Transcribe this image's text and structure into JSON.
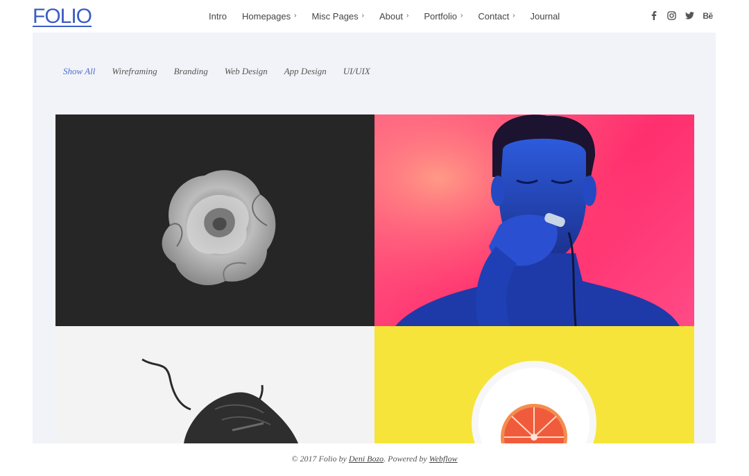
{
  "brand": {
    "logo_text": "FOLIO",
    "accent": "#3b5cc4"
  },
  "nav": {
    "items": [
      {
        "label": "Intro",
        "has_dropdown": false
      },
      {
        "label": "Homepages",
        "has_dropdown": true
      },
      {
        "label": "Misc Pages",
        "has_dropdown": true
      },
      {
        "label": "About",
        "has_dropdown": true
      },
      {
        "label": "Portfolio",
        "has_dropdown": true
      },
      {
        "label": "Contact",
        "has_dropdown": true
      },
      {
        "label": "Journal",
        "has_dropdown": false
      }
    ],
    "dropdown_glyph": "›"
  },
  "social": {
    "icons": [
      "facebook-icon",
      "instagram-icon",
      "twitter-icon",
      "behance-icon"
    ],
    "behance_label": "Bē"
  },
  "filters": {
    "items": [
      "Show All",
      "Wireframing",
      "Branding",
      "Web Design",
      "App Design",
      "UI/UIX"
    ],
    "active": "Show All",
    "active_color": "#4a6fc9"
  },
  "portfolio": {
    "tiles": [
      {
        "subject": "rose",
        "background": "#262626"
      },
      {
        "subject": "man-singing",
        "background": "#ff2f6e"
      },
      {
        "subject": "sneaker",
        "background": "#f3f3f3"
      },
      {
        "subject": "grapefruit",
        "background": "#f6e43a"
      }
    ]
  },
  "footer": {
    "prefix": "© 2017 Folio by ",
    "author": "Deni Bozo",
    "middle": ". Powered by ",
    "platform": "Webflow"
  }
}
